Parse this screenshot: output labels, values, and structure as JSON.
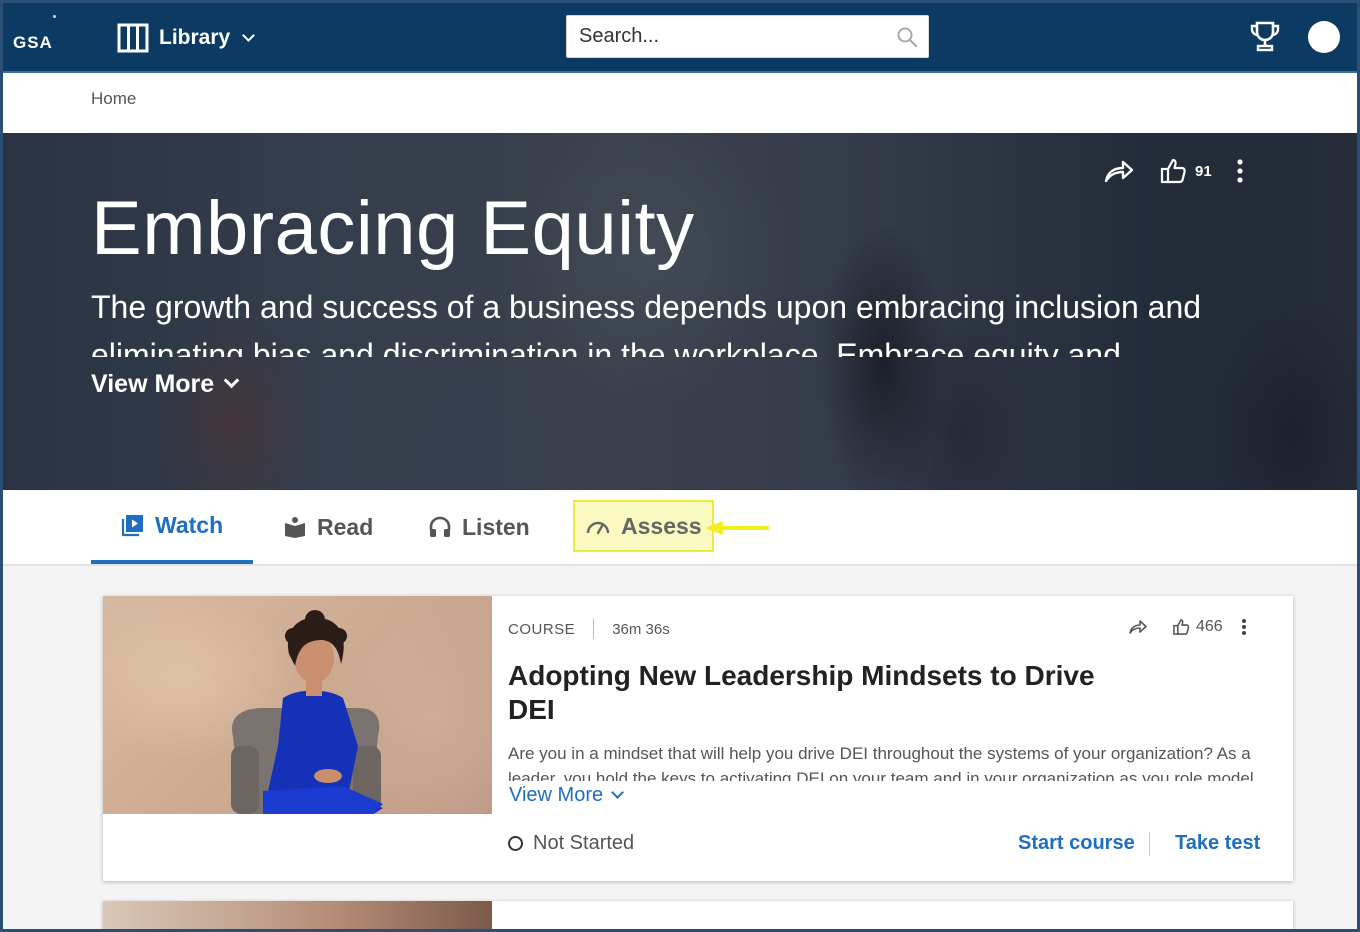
{
  "brand": {
    "logo_text": "GSA"
  },
  "topbar": {
    "library_label": "Library",
    "search_placeholder": "Search..."
  },
  "breadcrumb": {
    "home": "Home"
  },
  "hero": {
    "title": "Embracing Equity",
    "description": "The growth and success of a business depends upon embracing inclusion and eliminating bias and discrimination in the workplace.  Embrace equity and discover...",
    "view_more": "View More",
    "likes": "91"
  },
  "tabs": [
    {
      "label": "Watch",
      "icon": "play-video-icon",
      "active": true
    },
    {
      "label": "Read",
      "icon": "book-icon",
      "active": false
    },
    {
      "label": "Listen",
      "icon": "headphones-icon",
      "active": false
    },
    {
      "label": "Assess",
      "icon": "gauge-icon",
      "active": false,
      "highlighted": true
    }
  ],
  "card": {
    "type": "COURSE",
    "duration": "36m 36s",
    "likes": "466",
    "title": "Adopting New Leadership Mindsets to Drive DEI",
    "description": "Are you in a mindset that will help you drive DEI throughout the systems of your organization? As a leader, you hold the keys to activating DEI on your team and in your organization as you role model...",
    "view_more": "View More",
    "status": "Not Started",
    "start_label": "Start course",
    "test_label": "Take test"
  },
  "colors": {
    "topbar": "#0d3a62",
    "accent": "#1f6ec2",
    "highlight_fill": "#fbf9c2",
    "highlight_border": "#e8ec3c",
    "arrow": "#f2ee1d"
  }
}
